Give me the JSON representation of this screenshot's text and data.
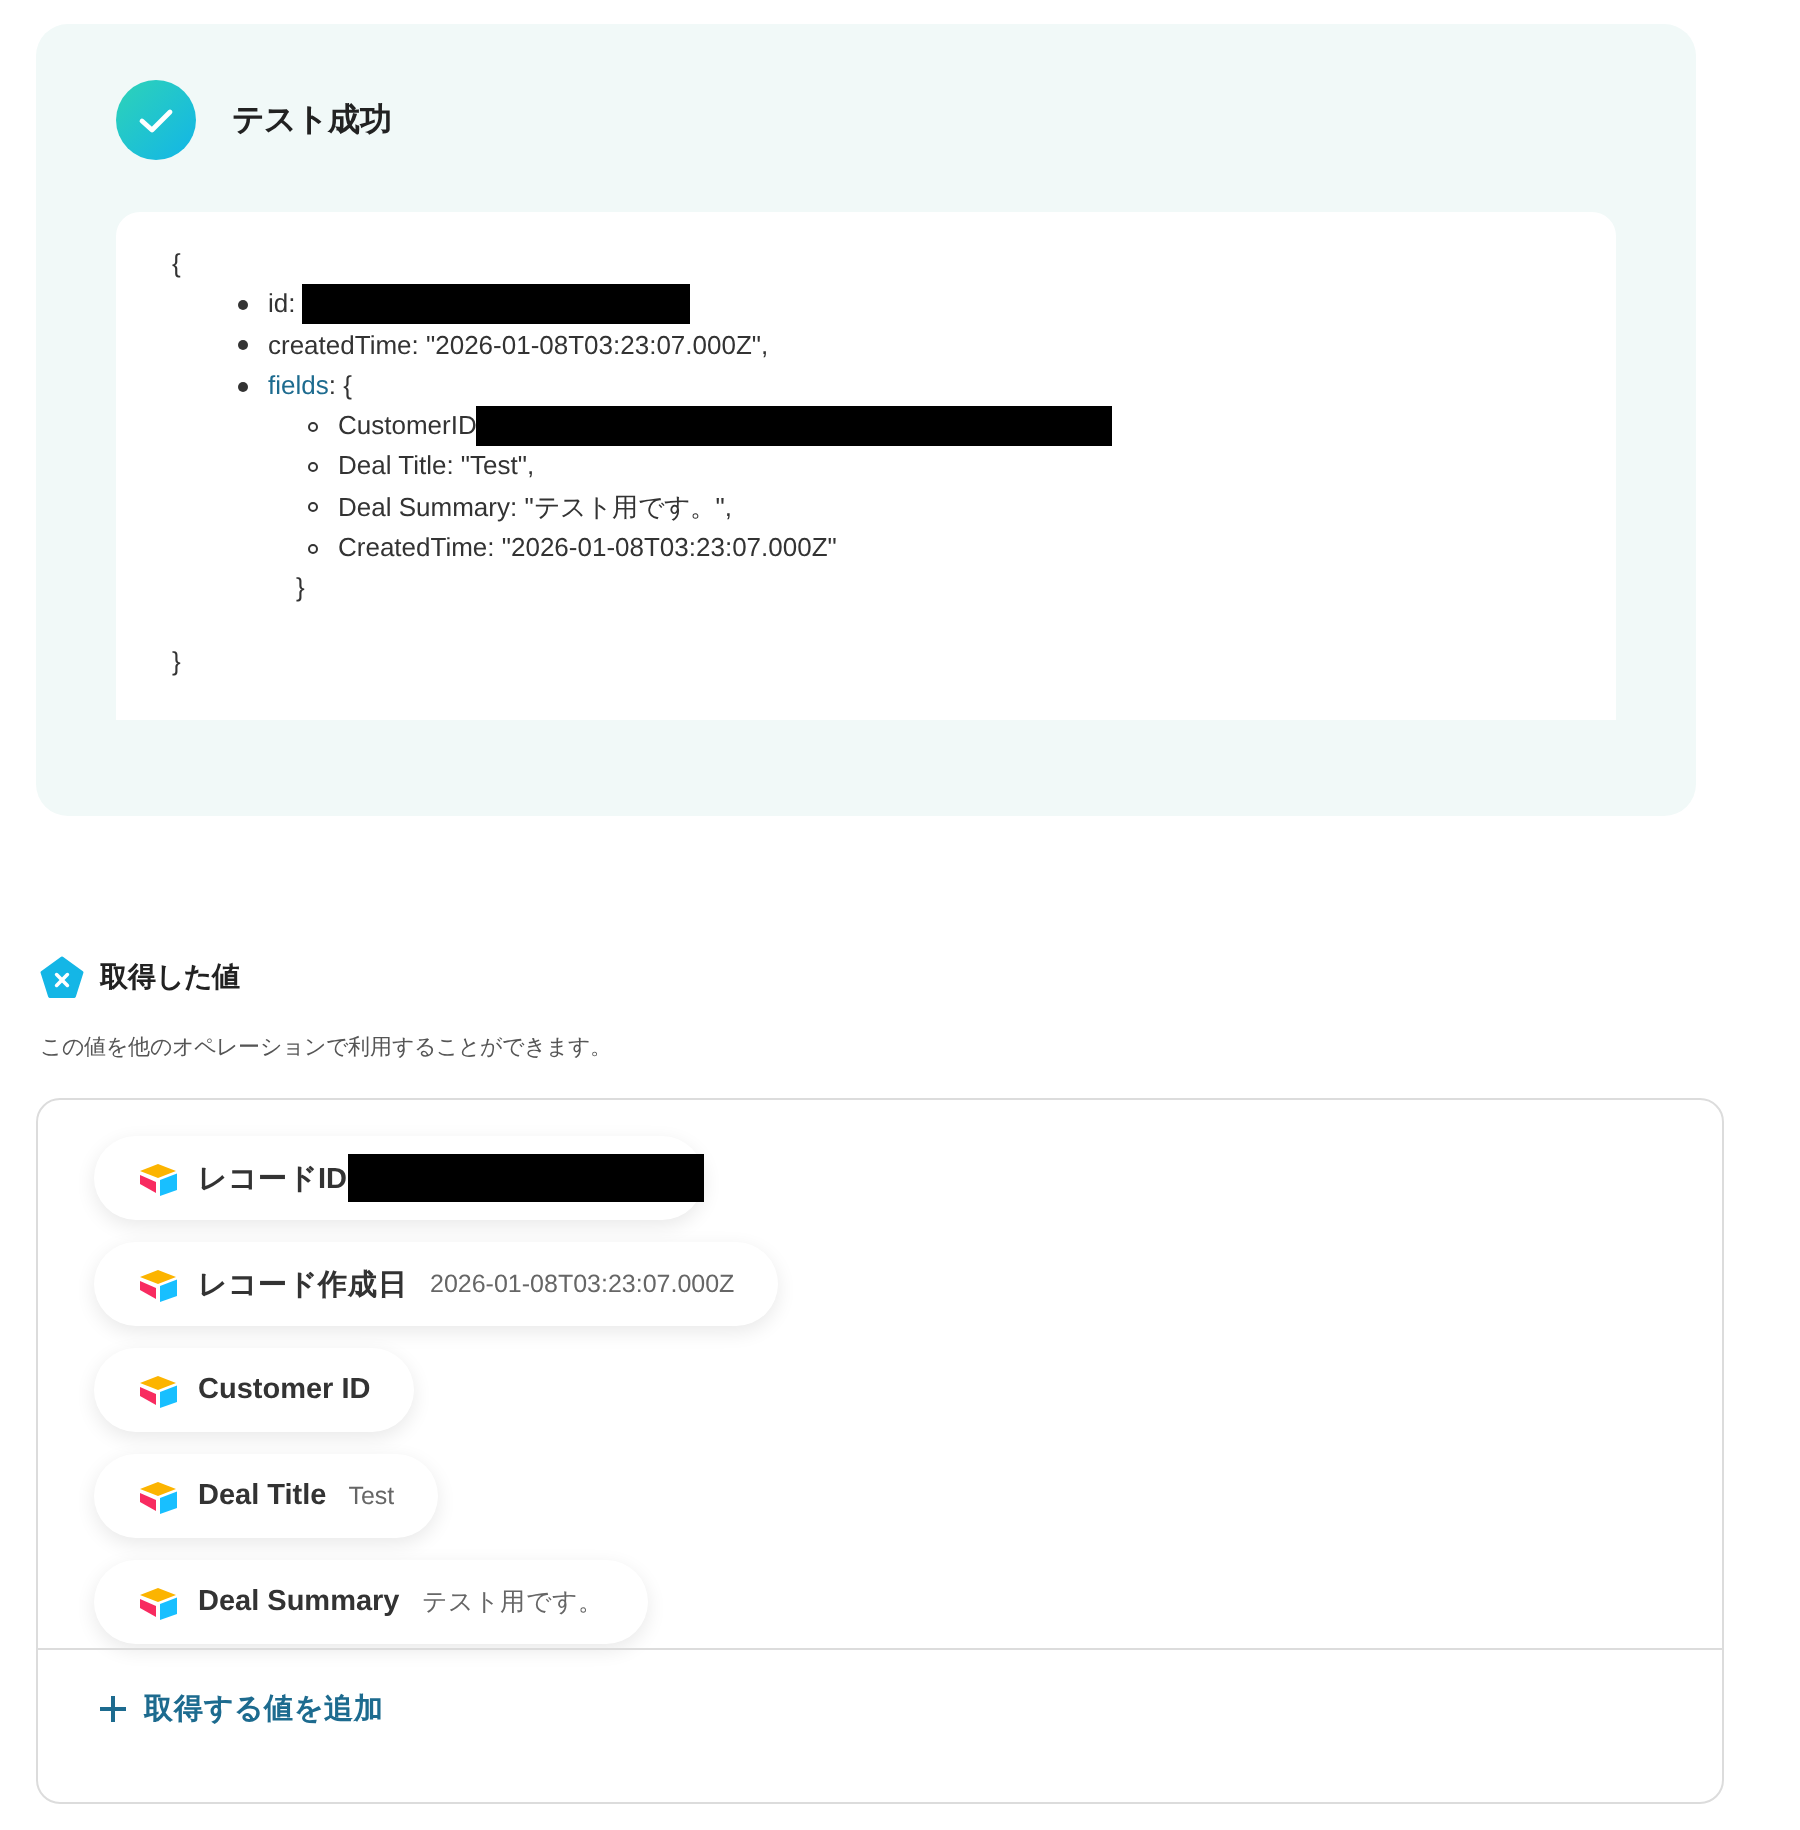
{
  "result": {
    "title": "テスト成功",
    "json_view": {
      "open": "{",
      "close": "}",
      "items": [
        {
          "key": "id:",
          "redacted": true
        },
        {
          "key": "createdTime: \"2026-01-08T03:23:07.000Z\","
        },
        {
          "key": "fields",
          "link": true,
          "after": ": {",
          "close": "}",
          "children": [
            {
              "key": "CustomerID",
              "redacted": true
            },
            {
              "key": "Deal Title: \"Test\","
            },
            {
              "key": "Deal Summary: \"テスト用です。\","
            },
            {
              "key": "CreatedTime: \"2026-01-08T03:23:07.000Z\""
            }
          ]
        }
      ]
    }
  },
  "values": {
    "title": "取得した値",
    "description": "この値を他のオペレーションで利用することができます。",
    "items": [
      {
        "label": "レコードID",
        "redacted": true
      },
      {
        "label": "レコード作成日",
        "value": "2026-01-08T03:23:07.000Z"
      },
      {
        "label": "Customer ID"
      },
      {
        "label": "Deal Title",
        "value": "Test"
      },
      {
        "label": "Deal Summary",
        "value": "テスト用です。"
      }
    ],
    "add_button": "取得する値を追加"
  }
}
